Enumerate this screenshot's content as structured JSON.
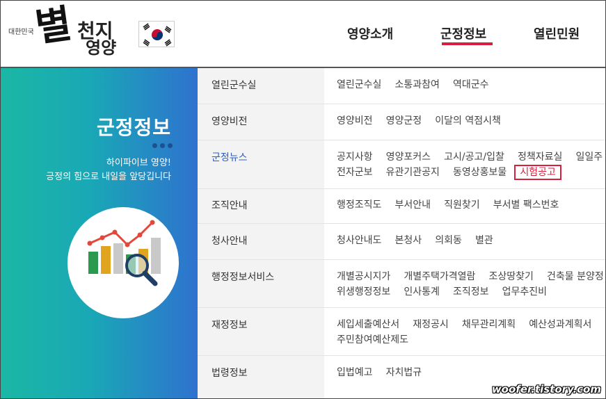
{
  "header": {
    "logo_small": "대한민국",
    "logo_mark": "별",
    "logo_text1": "천지",
    "logo_text2": "영양",
    "gnb": [
      "영양소개",
      "군정정보",
      "열린민원"
    ],
    "active_index": 1
  },
  "left_panel": {
    "title": "군정정보",
    "subtitle1": "하이파이브 영양!",
    "subtitle2": "긍정의 힘으로 내일을 앞당깁니다"
  },
  "menu": [
    {
      "category": "열린군수실",
      "lines": [
        [
          "열린군수실",
          "소통과참여",
          "역대군수"
        ]
      ]
    },
    {
      "category": "영양비전",
      "lines": [
        [
          "영양비전",
          "영양군정",
          "이달의 역점시책"
        ]
      ]
    },
    {
      "category": "군정뉴스",
      "active": true,
      "lines": [
        [
          "공지사항",
          "영양포커스",
          "고시/공고/입찰",
          "정책자료실",
          "일일주"
        ],
        [
          "전자군보",
          "유관기관공지",
          "동영상홍보물",
          "시험공고"
        ]
      ]
    },
    {
      "category": "조직안내",
      "lines": [
        [
          "행정조직도",
          "부서안내",
          "직원찾기",
          "부서별 팩스번호"
        ]
      ]
    },
    {
      "category": "청사안내",
      "lines": [
        [
          "청사안내도",
          "본청사",
          "의회동",
          "별관"
        ]
      ]
    },
    {
      "category": "행정정보서비스",
      "lines": [
        [
          "개별공시지가",
          "개별주택가격열람",
          "조상땅찾기",
          "건축물 분양정"
        ],
        [
          "위생행정정보",
          "인사통계",
          "조직정보",
          "업무추진비"
        ]
      ]
    },
    {
      "category": "재정정보",
      "lines": [
        [
          "세입세출예산서",
          "재정공시",
          "채무관리계획",
          "예산성과계획서"
        ],
        [
          "주민참여예산제도"
        ]
      ]
    },
    {
      "category": "법령정보",
      "lines": [
        [
          "입법예고",
          "자치법규"
        ]
      ]
    }
  ],
  "highlighted_link": "시험공고",
  "watermark": "woofer.tistory.com",
  "colors": {
    "accent": "#d6203b",
    "active_category": "#2b5fbf",
    "panel_start": "#1bb7a4",
    "panel_end": "#2f72cf"
  }
}
